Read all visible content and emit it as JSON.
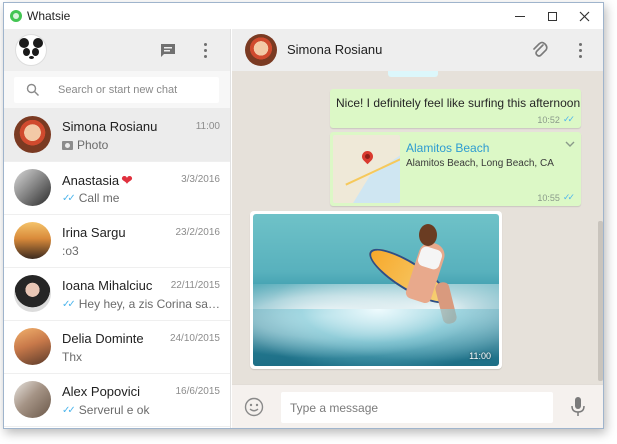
{
  "window": {
    "title": "Whatsie"
  },
  "sidebar": {
    "search_placeholder": "Search or start new chat",
    "chats": [
      {
        "name": "Simona Rosianu",
        "date": "11:00",
        "preview": "Photo",
        "kind": "photo",
        "active": true
      },
      {
        "name": "Anastasia",
        "emoji": "❤",
        "date": "3/3/2016",
        "preview": "Call me",
        "ticks": "✓✓"
      },
      {
        "name": "Irina Sargu",
        "date": "23/2/2016",
        "preview": ":o3"
      },
      {
        "name": "Ioana Mihalciuc",
        "date": "22/11/2015",
        "preview": "Hey hey, a zis Corina sa o sunăm",
        "ticks": "✓✓"
      },
      {
        "name": "Delia Dominte",
        "date": "24/10/2015",
        "preview": "Thx"
      },
      {
        "name": "Alex Popovici",
        "date": "16/6/2015",
        "preview": "Serverul e ok",
        "ticks": "✓✓"
      }
    ]
  },
  "conversation": {
    "contact_name": "Simona Rosianu",
    "messages": [
      {
        "type": "text",
        "text": "Nice! I definitely feel like surfing this afternoon",
        "time": "10:52",
        "ticks": "✓✓"
      },
      {
        "type": "location",
        "title": "Alamitos Beach",
        "address": "Alamitos Beach, Long Beach, CA",
        "time": "10:55",
        "ticks": "✓✓"
      },
      {
        "type": "image",
        "time": "11:00"
      }
    ],
    "composer_placeholder": "Type a message"
  },
  "colors": {
    "outgoing_bubble": "#dcf8c6",
    "chat_background": "#e6e1da",
    "header_background": "#eeeeee",
    "read_ticks": "#4fb6ec",
    "link": "#2e9cd1"
  }
}
